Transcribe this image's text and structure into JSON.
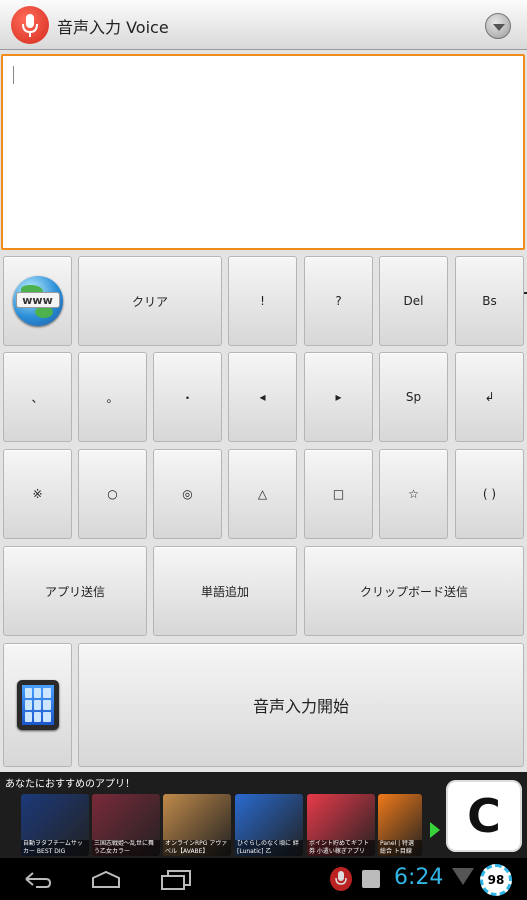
{
  "app": {
    "title": "音声入力 Voice"
  },
  "textarea": {
    "value": ""
  },
  "keys": {
    "row1": {
      "clear": "クリア",
      "exclaim": "!",
      "question": "?",
      "del": "Del",
      "bs": "Bs"
    },
    "row2": {
      "comma": "、",
      "period": "。",
      "middot": "・",
      "left": "◂",
      "right": "▸",
      "sp": "Sp",
      "enter": "↲"
    },
    "row3": {
      "kome": "※",
      "circle": "○",
      "double_circle": "◎",
      "triangle": "△",
      "square": "□",
      "star": "☆",
      "paren": "( )"
    },
    "row4": {
      "app_send": "アプリ送信",
      "add_word": "単語追加",
      "clipboard_send": "クリップボード送信"
    },
    "row5": {
      "start_voice": "音声入力開始"
    },
    "globe_label": "www"
  },
  "ad": {
    "title": "あなたにおすすめのアプリ！",
    "tiles": [
      {
        "caption": "自動ヲタブチームサッカー BEST DIG",
        "color": "#1b3a7a"
      },
      {
        "caption": "三国志戦姫～乱世に舞う乙女カラー",
        "color": "#7a2a3a"
      },
      {
        "caption": "オンラインRPG アヴァベル【AVABE】",
        "color": "#c08a4a"
      },
      {
        "caption": "ひぐらしのなく頃に 絆 [Lunatic] 乙",
        "color": "#2a6ad0"
      },
      {
        "caption": "ポイント貯めてギフト券 小遣い稼ぎアプリ",
        "color": "#e83a4a"
      },
      {
        "caption": "Panel | 特選 総合 ト目線",
        "color": "#f07a1a"
      }
    ],
    "logo_letter": "C"
  },
  "statusbar": {
    "time": "6:24",
    "battery": "98"
  },
  "colors": {
    "accent_orange": "#f08c1c",
    "clock_blue": "#33b5e5"
  }
}
